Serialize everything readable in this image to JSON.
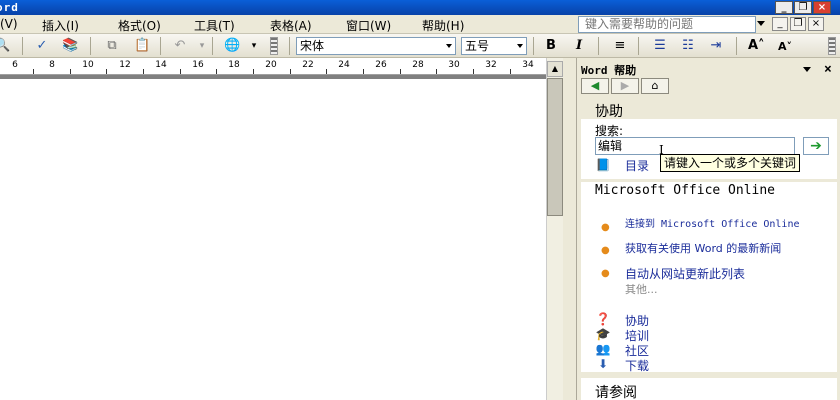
{
  "title_bar": {
    "title": "ord"
  },
  "menu": {
    "items": [
      "(V)",
      "插入(I)",
      "格式(O)",
      "工具(T)",
      "表格(A)",
      "窗口(W)",
      "帮助(H)"
    ],
    "help_placeholder": "键入需要帮助的问题"
  },
  "toolbar": {
    "font_name": "宋体",
    "font_size": "五号",
    "bold": "B",
    "italic": "I",
    "grow_font": "A˄",
    "shrink_font": "A˅"
  },
  "ruler": {
    "labels": [
      "6",
      "8",
      "10",
      "12",
      "14",
      "16",
      "18",
      "20",
      "22",
      "24",
      "26",
      "28",
      "30",
      "32",
      "34"
    ]
  },
  "task_pane": {
    "title": "Word 帮助",
    "assist_heading": "协助",
    "search_label": "搜索:",
    "search_value": "编辑",
    "toc_link": "目录",
    "tooltip": "请键入一个或多个关键词",
    "online_heading": "Microsoft Office Online",
    "online_links": [
      "连接到 Microsoft Office Online",
      "获取有关使用 Word 的最新新闻",
      "自动从网站更新此列表"
    ],
    "more": "其他...",
    "resources": [
      "协助",
      "培训",
      "社区",
      "下载"
    ],
    "see_also": "请参阅"
  },
  "colors": {
    "title_blue": "#0842a8",
    "link": "#1a2c9a",
    "bullet": "#e58b1b",
    "go_green": "#1e9a2e"
  }
}
